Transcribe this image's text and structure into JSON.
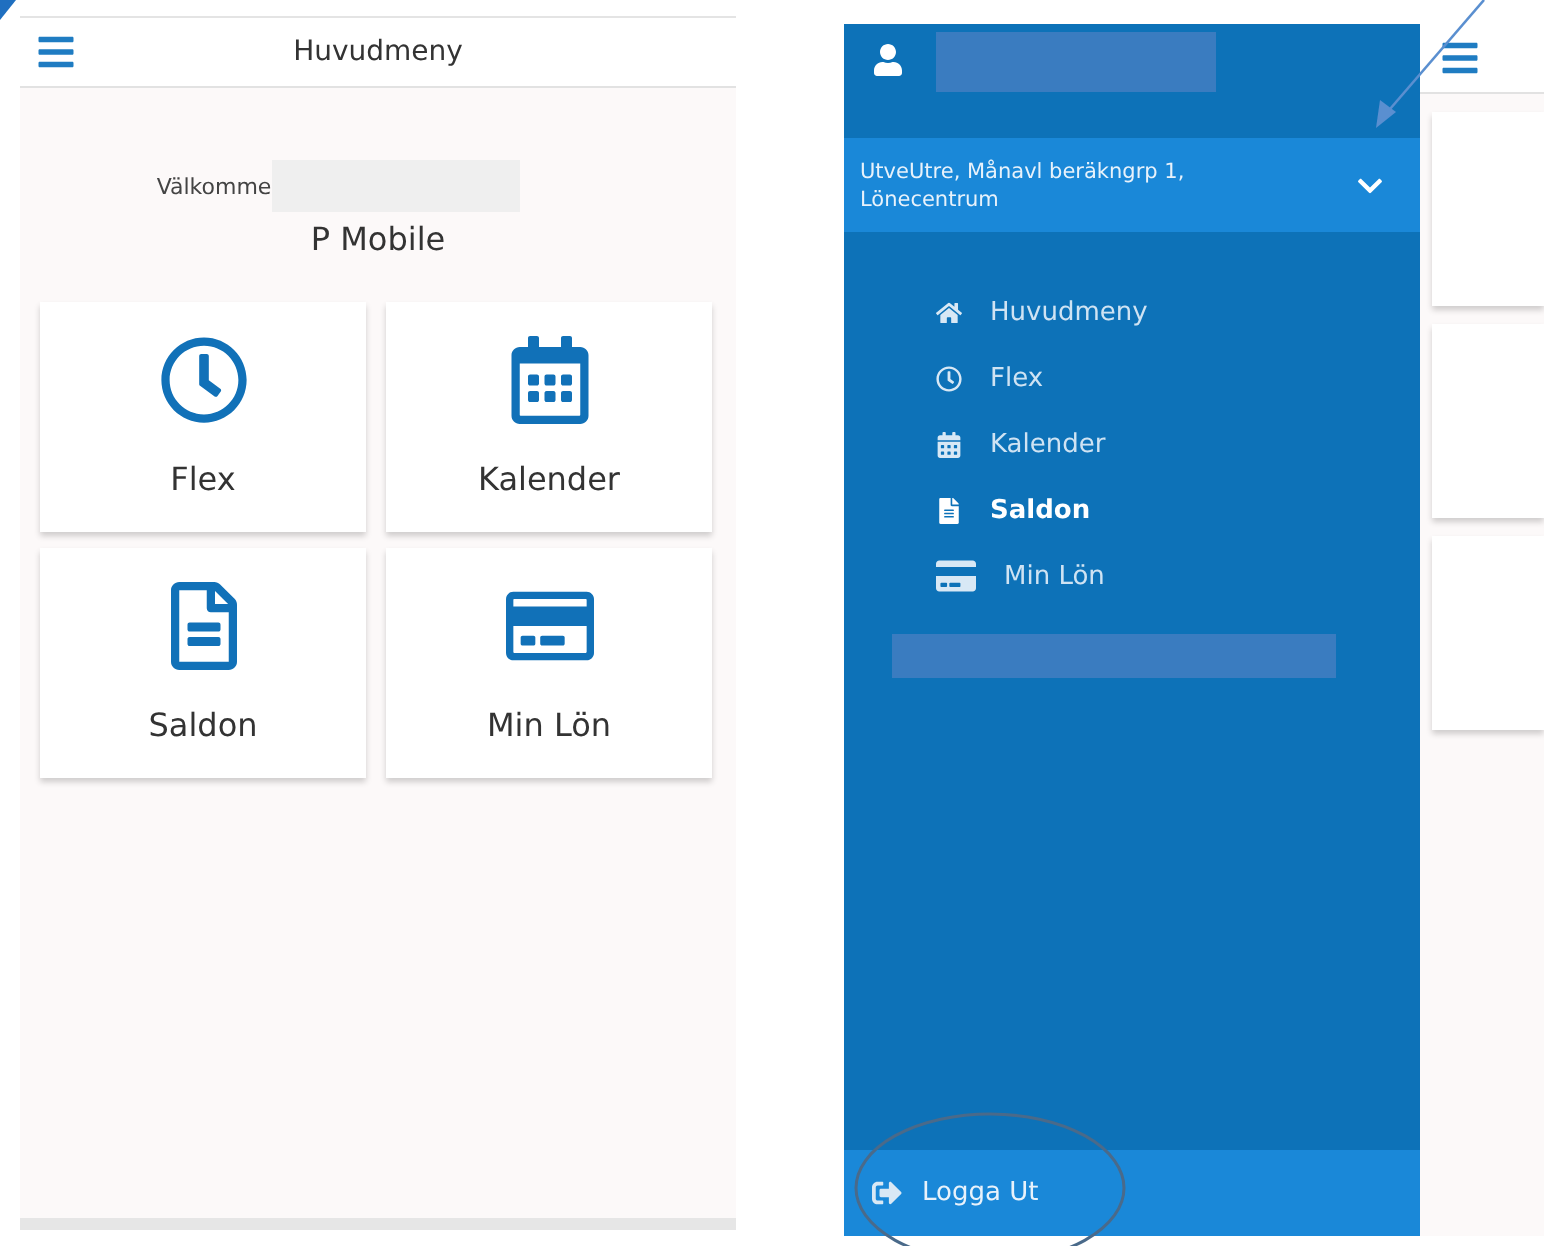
{
  "main_screen": {
    "title": "Huvudmeny",
    "welcome": "Välkomme",
    "app_name": "P Mobile",
    "tiles": [
      {
        "label": "Flex"
      },
      {
        "label": "Kalender"
      },
      {
        "label": "Saldon"
      },
      {
        "label": "Min Lön"
      }
    ]
  },
  "drawer": {
    "account": "UtveUtre, Månavl beräkngrp 1, Lönecentrum",
    "items": [
      {
        "label": "Huvudmeny",
        "selected": false
      },
      {
        "label": "Flex",
        "selected": false
      },
      {
        "label": "Kalender",
        "selected": false
      },
      {
        "label": "Saldon",
        "selected": true
      },
      {
        "label": "Min Lön",
        "selected": false
      }
    ],
    "logout": "Logga Ut"
  }
}
